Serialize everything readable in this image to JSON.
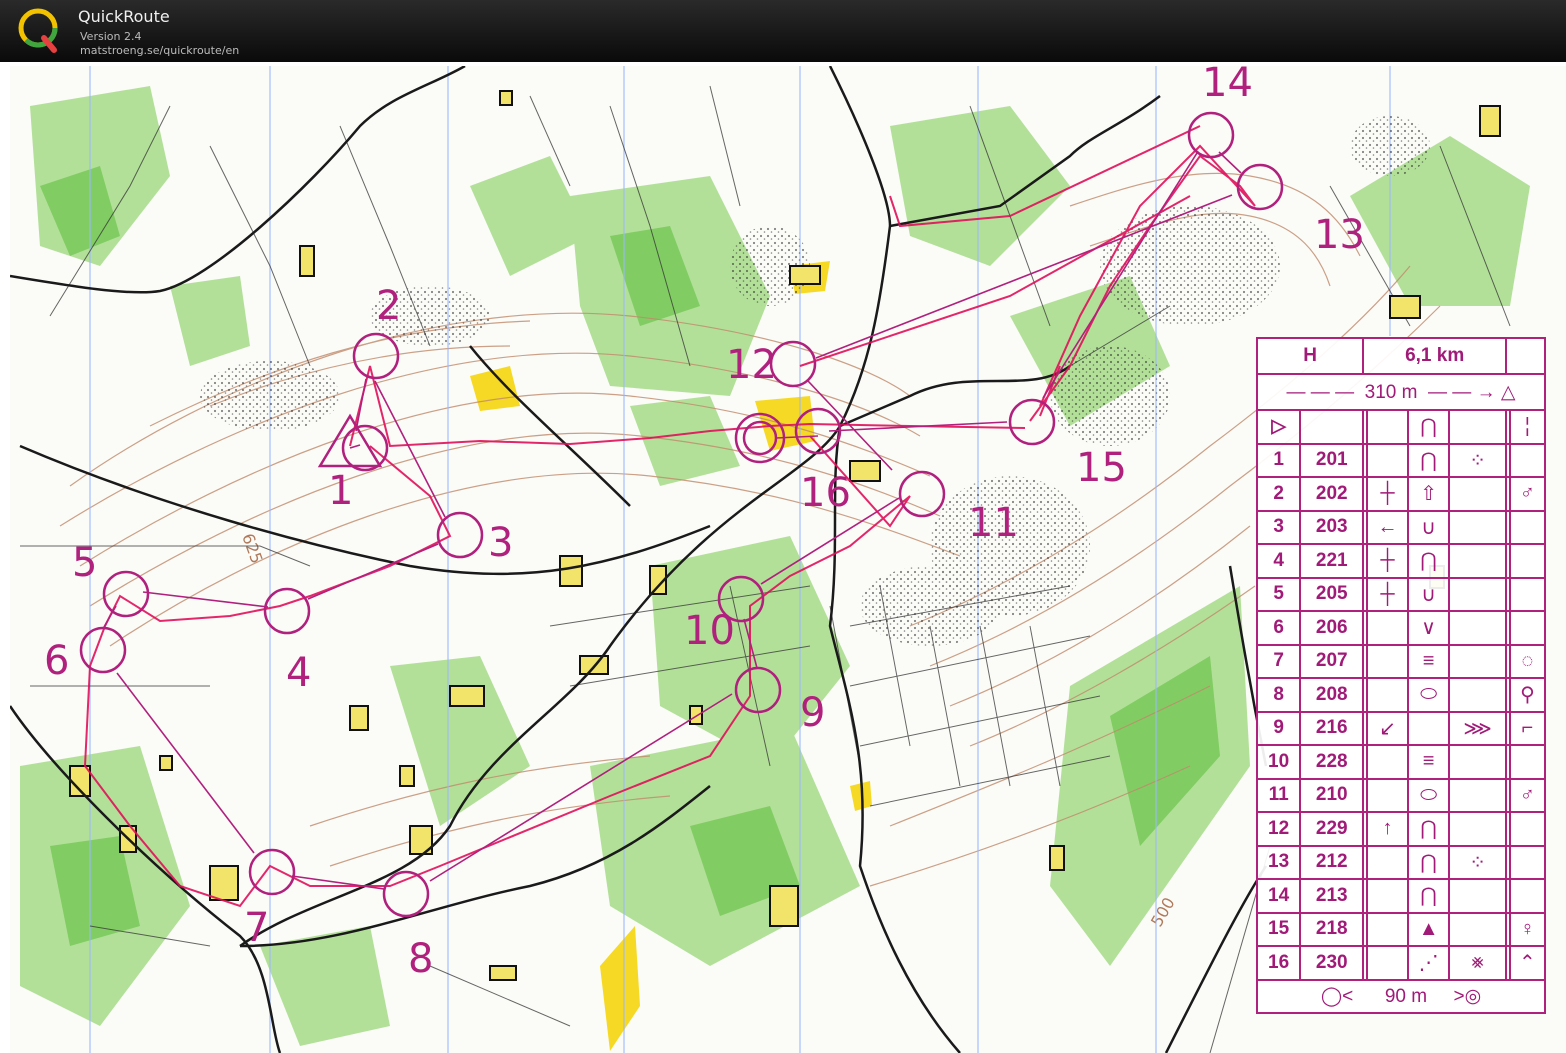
{
  "app": {
    "name": "QuickRoute",
    "version": "Version 2.4",
    "url": "matstroeng.se/quickroute/en"
  },
  "colors": {
    "course": "#b0207d",
    "route": "#e0105a",
    "forest": "#8fd46a",
    "open": "#f5d200",
    "contour": "#b07a5a",
    "road": "#222222",
    "magnetic_north": "#9ab8ff"
  },
  "map": {
    "contour_labels": [
      "625",
      "500"
    ],
    "controls": [
      {
        "label": "1"
      },
      {
        "label": "2"
      },
      {
        "label": "3"
      },
      {
        "label": "4"
      },
      {
        "label": "5"
      },
      {
        "label": "6"
      },
      {
        "label": "7"
      },
      {
        "label": "8"
      },
      {
        "label": "9"
      },
      {
        "label": "10"
      },
      {
        "label": "11"
      },
      {
        "label": "12"
      },
      {
        "label": "13"
      },
      {
        "label": "14"
      },
      {
        "label": "15"
      },
      {
        "label": "16"
      }
    ]
  },
  "description_sheet": {
    "course": "H",
    "length": "6,1 km",
    "start_distance": "310 m",
    "finish_distance": "90 m",
    "rows": [
      {
        "no": "1",
        "code": "201",
        "c": "",
        "d": "",
        "e": "knoll-icon",
        "f": "boulder-field-icon",
        "g": "",
        "h": ""
      },
      {
        "no": "2",
        "code": "202",
        "c": "",
        "d": "narrow-marsh-icon",
        "e": "small-tree-icon",
        "f": "",
        "g": "",
        "h": "east-side-icon"
      },
      {
        "no": "3",
        "code": "203",
        "c": "",
        "d": "west-arrow-icon",
        "e": "depression-icon",
        "f": "",
        "g": "",
        "h": ""
      },
      {
        "no": "4",
        "code": "221",
        "c": "",
        "d": "narrow-marsh-icon",
        "e": "knoll-icon",
        "f": "",
        "g": "",
        "h": ""
      },
      {
        "no": "5",
        "code": "205",
        "c": "",
        "d": "narrow-marsh-icon",
        "e": "depression-icon",
        "f": "",
        "g": "",
        "h": ""
      },
      {
        "no": "6",
        "code": "206",
        "c": "",
        "d": "",
        "e": "reentrant-icon",
        "f": "",
        "g": "",
        "h": ""
      },
      {
        "no": "7",
        "code": "207",
        "c": "",
        "d": "",
        "e": "marsh-icon",
        "f": "",
        "g": "",
        "h": "north-part-icon"
      },
      {
        "no": "8",
        "code": "208",
        "c": "",
        "d": "",
        "e": "elongated-icon",
        "f": "",
        "g": "",
        "h": "southeast-side-icon"
      },
      {
        "no": "9",
        "code": "216",
        "c": "",
        "d": "southwest-arrow-icon",
        "e": "",
        "f": "stony-ground-icon",
        "g": "",
        "h": "corner-icon"
      },
      {
        "no": "10",
        "code": "228",
        "c": "",
        "d": "",
        "e": "marsh-icon",
        "f": "",
        "g": "",
        "h": ""
      },
      {
        "no": "11",
        "code": "210",
        "c": "",
        "d": "",
        "e": "elongated-icon",
        "f": "",
        "g": "",
        "h": "northeast-part-icon"
      },
      {
        "no": "12",
        "code": "229",
        "c": "",
        "d": "north-arrow-icon",
        "e": "knoll-icon",
        "f": "",
        "g": "",
        "h": ""
      },
      {
        "no": "13",
        "code": "212",
        "c": "",
        "d": "",
        "e": "knoll-icon",
        "f": "boulder-field-icon",
        "g": "",
        "h": ""
      },
      {
        "no": "14",
        "code": "213",
        "c": "",
        "d": "",
        "e": "knoll-icon",
        "f": "",
        "g": "",
        "h": ""
      },
      {
        "no": "15",
        "code": "218",
        "c": "",
        "d": "",
        "e": "small-hill-icon",
        "f": "",
        "g": "",
        "h": "south-side-icon"
      },
      {
        "no": "16",
        "code": "230",
        "c": "",
        "d": "",
        "e": "thicket-edge-icon",
        "f": "crossing-icon",
        "g": "",
        "h": "top-icon"
      }
    ]
  }
}
